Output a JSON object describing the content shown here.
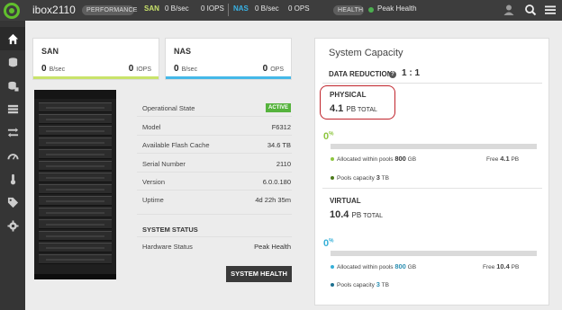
{
  "topbar": {
    "system_name": "ibox2110",
    "performance_label": "PERFORMANCE",
    "san_label": "SAN",
    "san_bw": "0 B/sec",
    "san_iops": "0 IOPS",
    "nas_label": "NAS",
    "nas_bw": "0 B/sec",
    "nas_ops": "0 OPS",
    "health_label": "HEALTH",
    "health_status": "Peak Health",
    "icons": [
      "user-icon",
      "search-icon",
      "menu-icon"
    ]
  },
  "sidebar": {
    "items": [
      {
        "icon": "home-icon"
      },
      {
        "icon": "storage-icon"
      },
      {
        "icon": "pools-icon"
      },
      {
        "icon": "hosts-icon"
      },
      {
        "icon": "replication-icon"
      },
      {
        "icon": "performance-gauge-icon"
      },
      {
        "icon": "temperature-icon"
      },
      {
        "icon": "tag-icon"
      },
      {
        "icon": "settings-icon"
      }
    ]
  },
  "san_card": {
    "title": "SAN",
    "bw_value": "0",
    "bw_unit": "B/sec",
    "iops_value": "0",
    "iops_unit": "IOPS"
  },
  "nas_card": {
    "title": "NAS",
    "bw_value": "0",
    "bw_unit": "B/sec",
    "ops_value": "0",
    "ops_unit": "OPS"
  },
  "system_info": {
    "rows": [
      {
        "label": "Operational State",
        "value": "ACTIVE"
      },
      {
        "label": "Model",
        "value": "F6312"
      },
      {
        "label": "Available Flash Cache",
        "value": "34.6 TB"
      },
      {
        "label": "Serial Number",
        "value": "2110"
      },
      {
        "label": "Version",
        "value": "6.0.0.180"
      },
      {
        "label": "Uptime",
        "value": "4d 22h 35m"
      }
    ],
    "status_title": "SYSTEM STATUS",
    "hardware_label": "Hardware Status",
    "hardware_value": "Peak Health",
    "button_label": "SYSTEM HEALTH"
  },
  "capacity": {
    "title": "System Capacity",
    "data_reduction_label": "DATA REDUCTION",
    "data_reduction_value": "1 : 1",
    "physical": {
      "label": "PHYSICAL",
      "value": "4.1",
      "unit": "PB",
      "total_label": "TOTAL",
      "percent": "0",
      "percent_sign": "%",
      "allocated_label": "Allocated within pools",
      "allocated_value": "800",
      "allocated_unit": "GB",
      "free_label": "Free",
      "free_value": "4.1",
      "free_unit": "PB",
      "pools_label": "Pools capacity",
      "pools_value": "3",
      "pools_unit": "TB",
      "fill_fraction": 0.0,
      "fill_color": "#8dc63f"
    },
    "virtual": {
      "label": "VIRTUAL",
      "value": "10.4",
      "unit": "PB",
      "total_label": "TOTAL",
      "percent": "0",
      "percent_sign": "%",
      "allocated_label": "Allocated within pools",
      "allocated_value": "800",
      "allocated_unit": "GB",
      "free_label": "Free",
      "free_value": "10.4",
      "free_unit": "PB",
      "pools_label": "Pools capacity",
      "pools_value": "3",
      "pools_unit": "TB",
      "fill_fraction": 0.0,
      "fill_color": "#36b0d8"
    }
  },
  "colors": {
    "san_accent": "#c9e36a",
    "nas_accent": "#45b8e8",
    "active_badge": "#56b33d",
    "highlight_ring": "#c0232b"
  }
}
